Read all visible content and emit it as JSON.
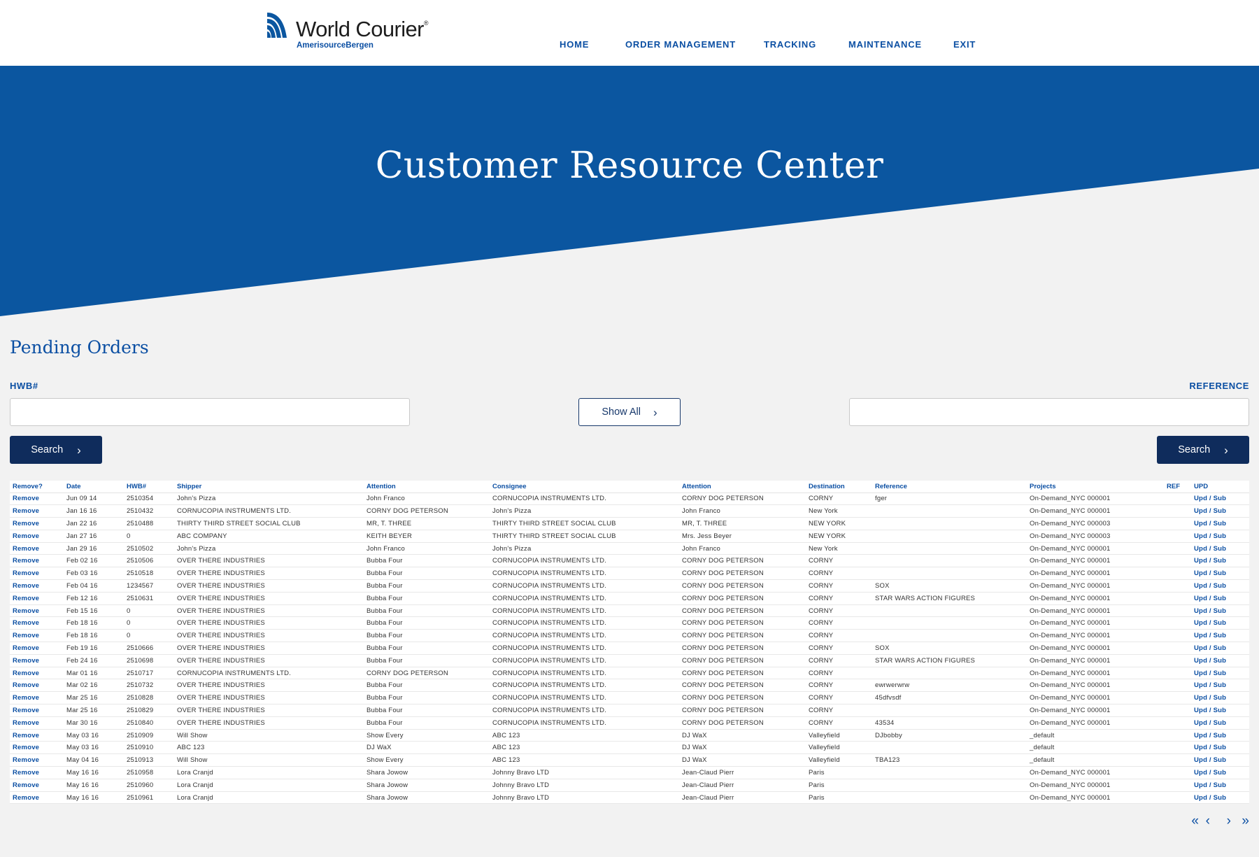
{
  "brand": {
    "name": "World Courier",
    "reg_mark": "®",
    "sub": "AmerisourceBergen",
    "colors": {
      "primary": "#0b56a0",
      "navy": "#0f2c5c",
      "link": "#0b4fa3"
    }
  },
  "nav": [
    {
      "label": "HOME"
    },
    {
      "label": "ORDER MANAGEMENT"
    },
    {
      "label": "TRACKING"
    },
    {
      "label": "MAINTENANCE"
    },
    {
      "label": "EXIT"
    }
  ],
  "hero": {
    "title": "Customer Resource Center"
  },
  "pending": {
    "title": "Pending Orders",
    "hwb_label": "HWB#",
    "reference_label": "REFERENCE",
    "hwb_value": "",
    "reference_value": "",
    "show_all_label": "Show All",
    "search_label": "Search",
    "search_icon": "chevron-right-icon"
  },
  "table": {
    "columns": [
      "Remove?",
      "Date",
      "HWB#",
      "Shipper",
      "Attention",
      "Consignee",
      "Attention",
      "Destination",
      "Reference",
      "Projects",
      "REF",
      "UPD"
    ],
    "rows": [
      [
        "Remove",
        "Jun 09 14",
        "2510354",
        "John's Pizza",
        "John Franco",
        "CORNUCOPIA INSTRUMENTS LTD.",
        "CORNY DOG PETERSON",
        "CORNY",
        "fger",
        "On-Demand_NYC 000001",
        "",
        "Upd / Sub"
      ],
      [
        "Remove",
        "Jan 16 16",
        "2510432",
        "CORNUCOPIA INSTRUMENTS LTD.",
        "CORNY DOG PETERSON",
        "John's Pizza",
        "John Franco",
        "New York",
        "",
        "On-Demand_NYC 000001",
        "",
        "Upd / Sub"
      ],
      [
        "Remove",
        "Jan 22 16",
        "2510488",
        "THIRTY THIRD STREET SOCIAL CLUB",
        "MR, T. THREE",
        "THIRTY THIRD STREET SOCIAL CLUB",
        "MR, T. THREE",
        "NEW YORK",
        "",
        "On-Demand_NYC 000003",
        "",
        "Upd / Sub"
      ],
      [
        "Remove",
        "Jan 27 16",
        "0",
        "ABC COMPANY",
        "KEITH BEYER",
        "THIRTY THIRD STREET SOCIAL CLUB",
        "Mrs. Jess Beyer",
        "NEW YORK",
        "",
        "On-Demand_NYC 000003",
        "",
        "Upd / Sub"
      ],
      [
        "Remove",
        "Jan 29 16",
        "2510502",
        "John's Pizza",
        "John Franco",
        "John's Pizza",
        "John Franco",
        "New York",
        "",
        "On-Demand_NYC 000001",
        "",
        "Upd / Sub"
      ],
      [
        "Remove",
        "Feb 02 16",
        "2510506",
        "OVER THERE INDUSTRIES",
        "Bubba Four",
        "CORNUCOPIA INSTRUMENTS LTD.",
        "CORNY DOG PETERSON",
        "CORNY",
        "",
        "On-Demand_NYC 000001",
        "",
        "Upd / Sub"
      ],
      [
        "Remove",
        "Feb 03 16",
        "2510518",
        "OVER THERE INDUSTRIES",
        "Bubba Four",
        "CORNUCOPIA INSTRUMENTS LTD.",
        "CORNY DOG PETERSON",
        "CORNY",
        "",
        "On-Demand_NYC 000001",
        "",
        "Upd / Sub"
      ],
      [
        "Remove",
        "Feb 04 16",
        "1234567",
        "OVER THERE INDUSTRIES",
        "Bubba Four",
        "CORNUCOPIA INSTRUMENTS LTD.",
        "CORNY DOG PETERSON",
        "CORNY",
        "SOX",
        "On-Demand_NYC 000001",
        "",
        "Upd / Sub"
      ],
      [
        "Remove",
        "Feb 12 16",
        "2510631",
        "OVER THERE INDUSTRIES",
        "Bubba Four",
        "CORNUCOPIA INSTRUMENTS LTD.",
        "CORNY DOG PETERSON",
        "CORNY",
        "STAR WARS ACTION FIGURES",
        "On-Demand_NYC 000001",
        "",
        "Upd / Sub"
      ],
      [
        "Remove",
        "Feb 15 16",
        "0",
        "OVER THERE INDUSTRIES",
        "Bubba Four",
        "CORNUCOPIA INSTRUMENTS LTD.",
        "CORNY DOG PETERSON",
        "CORNY",
        "",
        "On-Demand_NYC 000001",
        "",
        "Upd / Sub"
      ],
      [
        "Remove",
        "Feb 18 16",
        "0",
        "OVER THERE INDUSTRIES",
        "Bubba Four",
        "CORNUCOPIA INSTRUMENTS LTD.",
        "CORNY DOG PETERSON",
        "CORNY",
        "",
        "On-Demand_NYC 000001",
        "",
        "Upd / Sub"
      ],
      [
        "Remove",
        "Feb 18 16",
        "0",
        "OVER THERE INDUSTRIES",
        "Bubba Four",
        "CORNUCOPIA INSTRUMENTS LTD.",
        "CORNY DOG PETERSON",
        "CORNY",
        "",
        "On-Demand_NYC 000001",
        "",
        "Upd / Sub"
      ],
      [
        "Remove",
        "Feb 19 16",
        "2510666",
        "OVER THERE INDUSTRIES",
        "Bubba Four",
        "CORNUCOPIA INSTRUMENTS LTD.",
        "CORNY DOG PETERSON",
        "CORNY",
        "SOX",
        "On-Demand_NYC 000001",
        "",
        "Upd / Sub"
      ],
      [
        "Remove",
        "Feb 24 16",
        "2510698",
        "OVER THERE INDUSTRIES",
        "Bubba Four",
        "CORNUCOPIA INSTRUMENTS LTD.",
        "CORNY DOG PETERSON",
        "CORNY",
        "STAR WARS ACTION FIGURES",
        "On-Demand_NYC 000001",
        "",
        "Upd / Sub"
      ],
      [
        "Remove",
        "Mar 01 16",
        "2510717",
        "CORNUCOPIA INSTRUMENTS LTD.",
        "CORNY DOG PETERSON",
        "CORNUCOPIA INSTRUMENTS LTD.",
        "CORNY DOG PETERSON",
        "CORNY",
        "",
        "On-Demand_NYC 000001",
        "",
        "Upd / Sub"
      ],
      [
        "Remove",
        "Mar 02 16",
        "2510732",
        "OVER THERE INDUSTRIES",
        "Bubba Four",
        "CORNUCOPIA INSTRUMENTS LTD.",
        "CORNY DOG PETERSON",
        "CORNY",
        "ewrwerwrw",
        "On-Demand_NYC 000001",
        "",
        "Upd / Sub"
      ],
      [
        "Remove",
        "Mar 25 16",
        "2510828",
        "OVER THERE INDUSTRIES",
        "Bubba Four",
        "CORNUCOPIA INSTRUMENTS LTD.",
        "CORNY DOG PETERSON",
        "CORNY",
        "45dfvsdf",
        "On-Demand_NYC 000001",
        "",
        "Upd / Sub"
      ],
      [
        "Remove",
        "Mar 25 16",
        "2510829",
        "OVER THERE INDUSTRIES",
        "Bubba Four",
        "CORNUCOPIA INSTRUMENTS LTD.",
        "CORNY DOG PETERSON",
        "CORNY",
        "",
        "On-Demand_NYC 000001",
        "",
        "Upd / Sub"
      ],
      [
        "Remove",
        "Mar 30 16",
        "2510840",
        "OVER THERE INDUSTRIES",
        "Bubba Four",
        "CORNUCOPIA INSTRUMENTS LTD.",
        "CORNY DOG PETERSON",
        "CORNY",
        "43534",
        "On-Demand_NYC 000001",
        "",
        "Upd / Sub"
      ],
      [
        "Remove",
        "May 03 16",
        "2510909",
        "Will Show",
        "Show Every",
        "ABC 123",
        "DJ WaX",
        "Valleyfield",
        "DJbobby",
        "_default",
        "",
        "Upd / Sub"
      ],
      [
        "Remove",
        "May 03 16",
        "2510910",
        "ABC 123",
        "DJ WaX",
        "ABC 123",
        "DJ WaX",
        "Valleyfield",
        "",
        "_default",
        "",
        "Upd / Sub"
      ],
      [
        "Remove",
        "May 04 16",
        "2510913",
        "Will Show",
        "Show Every",
        "ABC 123",
        "DJ WaX",
        "Valleyfield",
        "TBA123",
        "_default",
        "",
        "Upd / Sub"
      ],
      [
        "Remove",
        "May 16 16",
        "2510958",
        "Lora Cranjd",
        "Shara Jowow",
        "Johnny Bravo LTD",
        "Jean-Claud Pierr",
        "Paris",
        "",
        "On-Demand_NYC 000001",
        "",
        "Upd / Sub"
      ],
      [
        "Remove",
        "May 16 16",
        "2510960",
        "Lora Cranjd",
        "Shara Jowow",
        "Johnny Bravo LTD",
        "Jean-Claud Pierr",
        "Paris",
        "",
        "On-Demand_NYC 000001",
        "",
        "Upd / Sub"
      ],
      [
        "Remove",
        "May 16 16",
        "2510961",
        "Lora Cranjd",
        "Shara Jowow",
        "Johnny Bravo LTD",
        "Jean-Claud Pierr",
        "Paris",
        "",
        "On-Demand_NYC 000001",
        "",
        "Upd / Sub"
      ]
    ]
  },
  "pagination": {
    "first": "«",
    "prev": "‹",
    "next": "›",
    "last": "»"
  }
}
